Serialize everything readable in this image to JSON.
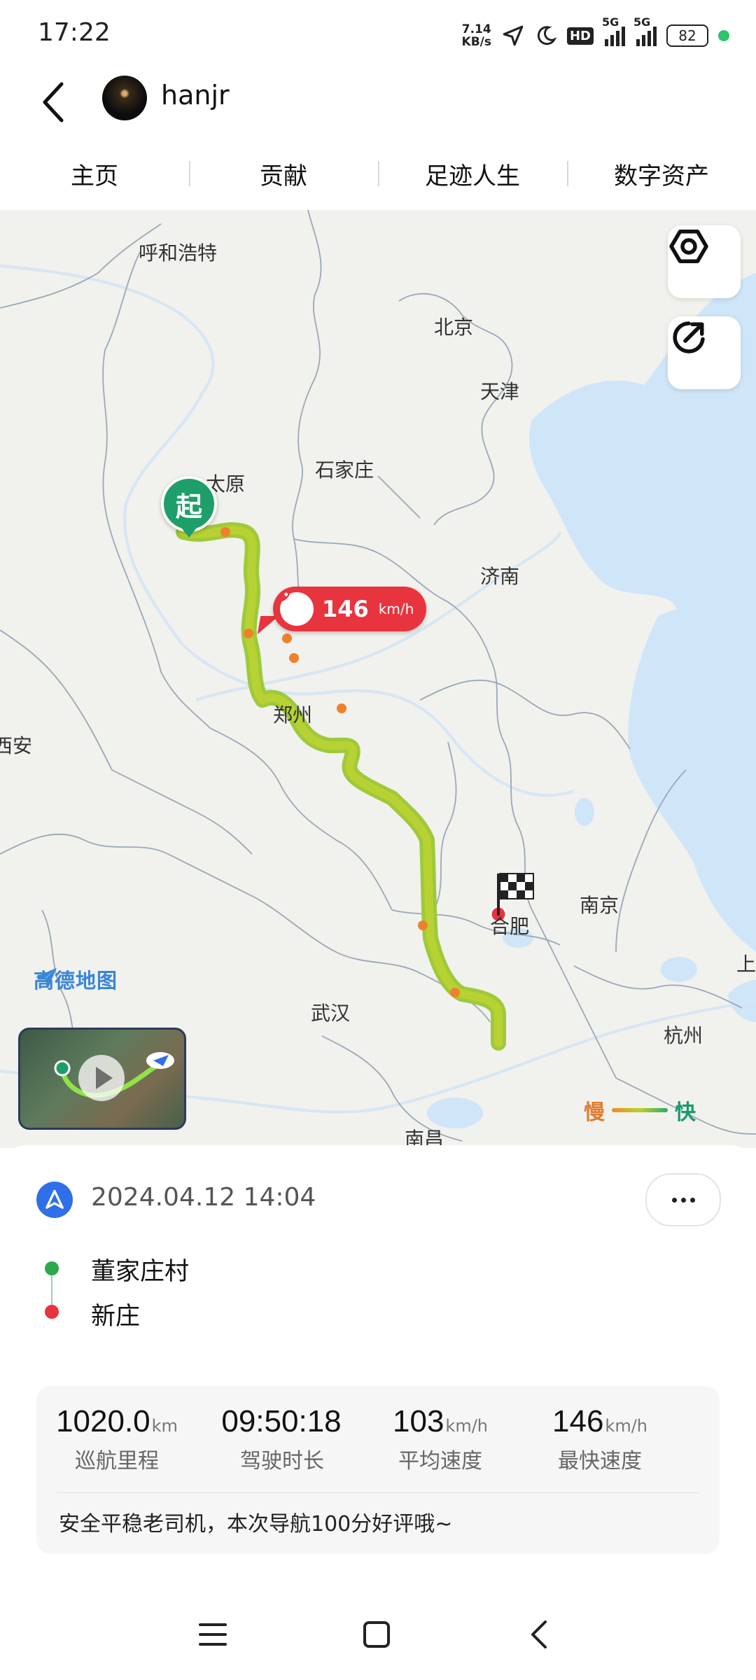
{
  "status_bar": {
    "time": "17:22",
    "net_speed_value": "7.14",
    "net_speed_unit": "KB/s",
    "hd_label": "HD",
    "signal_label": "5G",
    "battery": "82"
  },
  "header": {
    "username": "hanjr"
  },
  "tabs": [
    {
      "label": "主页"
    },
    {
      "label": "贡献"
    },
    {
      "label": "足迹人生"
    },
    {
      "label": "数字资产"
    }
  ],
  "map": {
    "cities": {
      "hohhot": "呼和浩特",
      "beijing": "北京",
      "tianjin": "天津",
      "taiyuan": "太原",
      "shijiazhuang": "石家庄",
      "jinan": "济南",
      "zhengzhou": "郑州",
      "xian": "西安",
      "hefei": "合肥",
      "nanjing": "南京",
      "wuhan": "武汉",
      "hangzhou": "杭州",
      "nanchang": "南昌",
      "shanghai": "上"
    },
    "start_marker": "起",
    "top_speed_value": "146",
    "top_speed_unit": "km/h",
    "provider": "高德地图",
    "legend_slow": "慢",
    "legend_fast": "快",
    "colors": {
      "slow": "#f08a2a",
      "mid": "#b8d12a",
      "fast": "#2eaa6a",
      "water": "#cfe6f9"
    }
  },
  "trip": {
    "datetime": "2024.04.12 14:04",
    "origin": "董家庄村",
    "destination": "新庄",
    "stats": [
      {
        "value": "1020.0",
        "unit": "km",
        "label": "巡航里程"
      },
      {
        "value": "09:50:18",
        "unit": "",
        "label": "驾驶时长"
      },
      {
        "value": "103",
        "unit": "km/h",
        "label": "平均速度"
      },
      {
        "value": "146",
        "unit": "km/h",
        "label": "最快速度"
      }
    ],
    "comment": "安全平稳老司机，本次导航100分好评哦~"
  }
}
